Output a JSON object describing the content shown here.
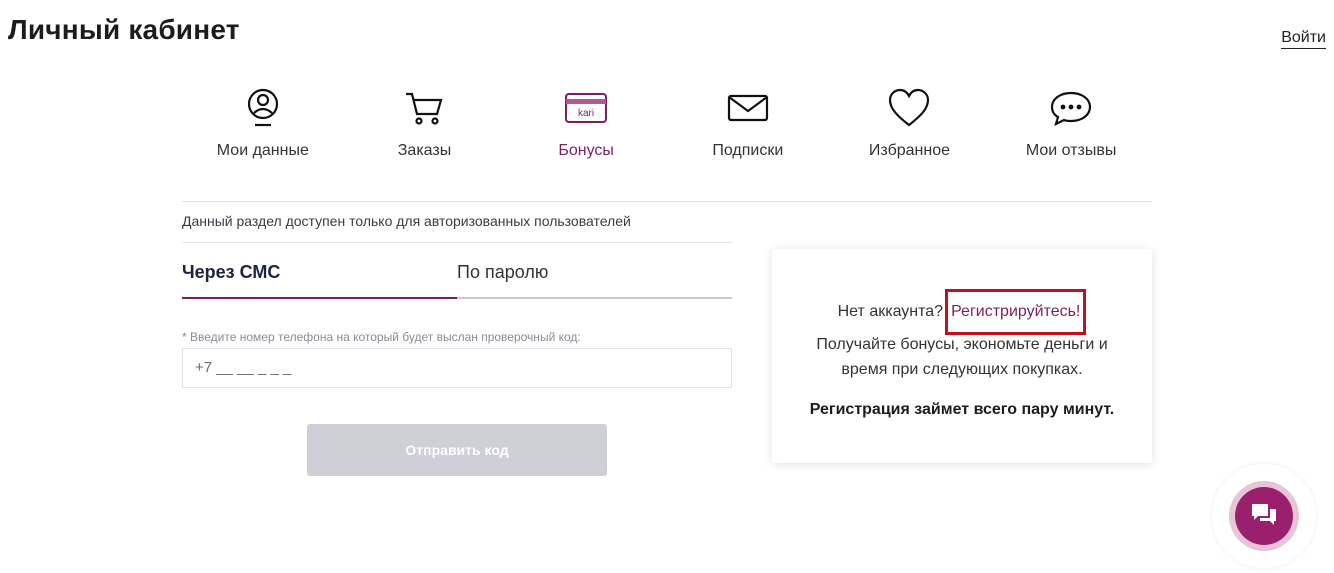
{
  "header": {
    "title": "Личный кабинет",
    "login_label": "Войти"
  },
  "nav": {
    "items": [
      {
        "label": "Мои данные",
        "icon": "user-profile-icon",
        "active": false
      },
      {
        "label": "Заказы",
        "icon": "cart-icon",
        "active": false
      },
      {
        "label": "Бонусы",
        "icon": "bonus-card-icon",
        "active": true
      },
      {
        "label": "Подписки",
        "icon": "envelope-icon",
        "active": false
      },
      {
        "label": "Избранное",
        "icon": "heart-icon",
        "active": false
      },
      {
        "label": "Мои отзывы",
        "icon": "chat-bubble-icon",
        "active": false
      }
    ],
    "card_text": "kari"
  },
  "auth": {
    "notice": "Данный раздел доступен только для авторизованных пользователей",
    "tabs": [
      {
        "label": "Через СМС",
        "active": true
      },
      {
        "label": "По паролю",
        "active": false
      }
    ],
    "phone_hint": "* Введите номер телефона на который будет выслан проверочный код:",
    "phone_placeholder": "+7 __ __ _ _ _",
    "send_label": "Отправить код"
  },
  "register": {
    "no_account": "Нет аккаунта?",
    "link_label": "Регистрируйтесь!",
    "benefits": "Получайте бонусы, экономьте деньги и время при следующих покупках.",
    "note": "Регистрация займет всего пару минут."
  },
  "colors": {
    "accent": "#7c1f5e",
    "chat_button": "#9a1f6d",
    "highlight_border": "#c0121b",
    "disabled_button": "#cfd0d7"
  }
}
